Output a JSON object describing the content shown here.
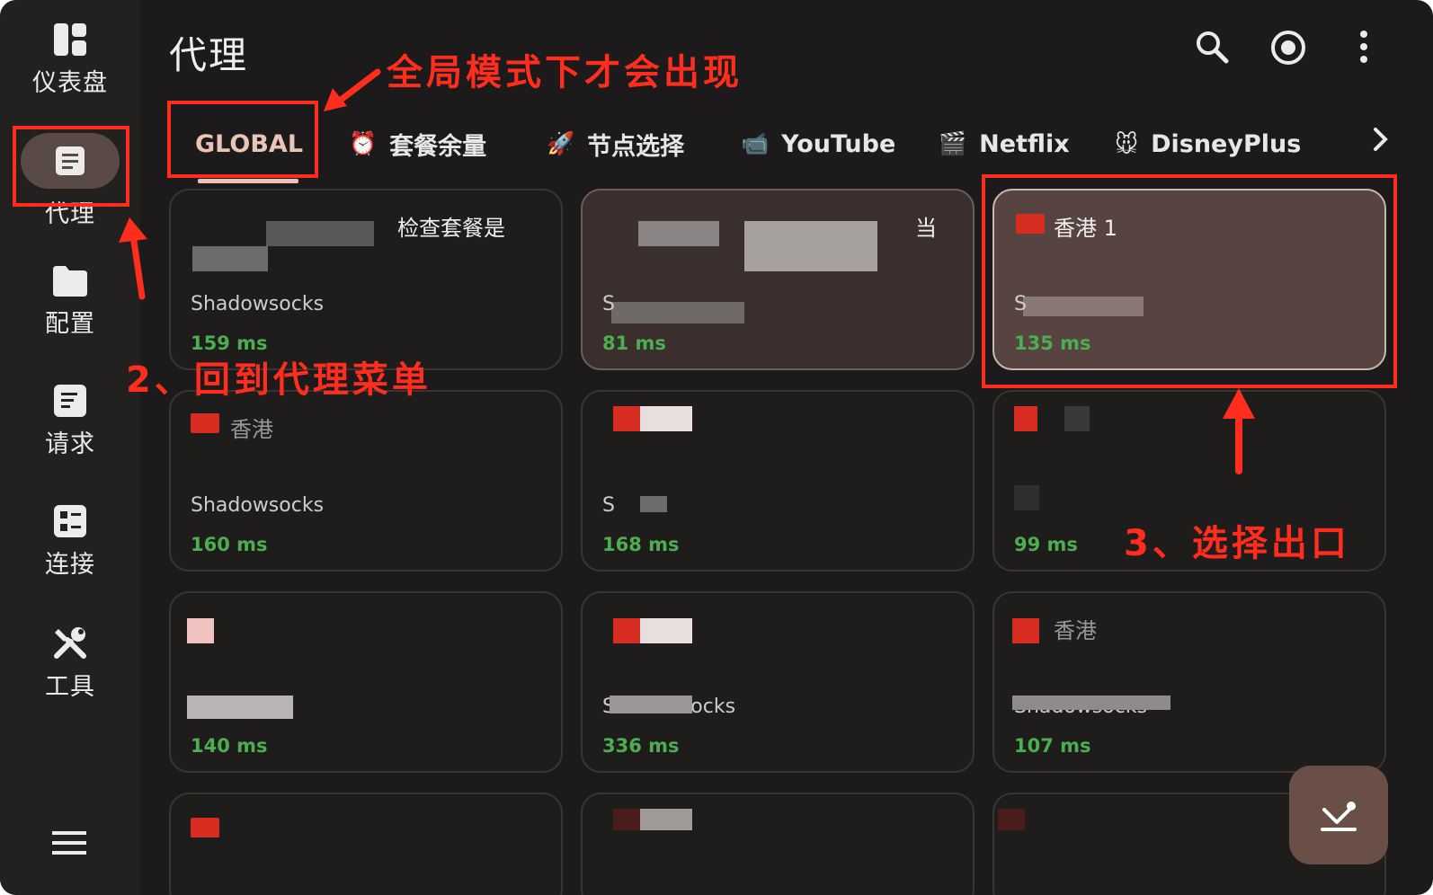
{
  "sidebar": {
    "items": [
      {
        "label": "仪表盘",
        "icon": "dashboard-icon"
      },
      {
        "label": "代理",
        "icon": "proxy-list-icon",
        "active": true
      },
      {
        "label": "配置",
        "icon": "folder-icon"
      },
      {
        "label": "请求",
        "icon": "request-icon"
      },
      {
        "label": "连接",
        "icon": "connection-icon"
      },
      {
        "label": "工具",
        "icon": "tools-icon"
      }
    ],
    "menu_icon": "hamburger-menu-icon"
  },
  "header": {
    "title": "代理",
    "icons": [
      "search-icon",
      "target-icon",
      "more-vert-icon"
    ]
  },
  "tabs": [
    {
      "label": "GLOBAL",
      "emoji": "",
      "active": true
    },
    {
      "label": "套餐余量",
      "emoji": "⏰"
    },
    {
      "label": "节点选择",
      "emoji": "🚀"
    },
    {
      "label": "YouTube",
      "emoji": "📹"
    },
    {
      "label": "Netflix",
      "emoji": "🎬"
    },
    {
      "label": "DisneyPlus",
      "emoji": "🐭"
    }
  ],
  "cards": [
    {
      "name": "检查套餐是",
      "type": "Shadowsocks",
      "delay": "159 ms"
    },
    {
      "name": "当",
      "type": "S",
      "delay": "81 ms"
    },
    {
      "name": "香港 1",
      "type": "S",
      "delay": "135 ms",
      "selected": true
    },
    {
      "name": "香港",
      "type": "Shadowsocks",
      "delay": "160 ms"
    },
    {
      "name": "",
      "type": "S",
      "delay": "168 ms"
    },
    {
      "name": "",
      "type": "",
      "delay": "99 ms"
    },
    {
      "name": "",
      "type": "",
      "delay": "140 ms"
    },
    {
      "name": "",
      "type": "Shadowsocks",
      "delay": "336 ms"
    },
    {
      "name": "香港",
      "type": "Shadowsocks",
      "delay": "107 ms"
    }
  ],
  "annotations": {
    "global_only": "全局模式下才会出现",
    "step2": "2、回到代理菜单",
    "step3": "3、选择出口"
  },
  "fab_icon": "locate-current-icon",
  "colors": {
    "accent": "#eac4b4",
    "delay_green": "#4cae50",
    "annotation_red": "#ff2d1e"
  }
}
